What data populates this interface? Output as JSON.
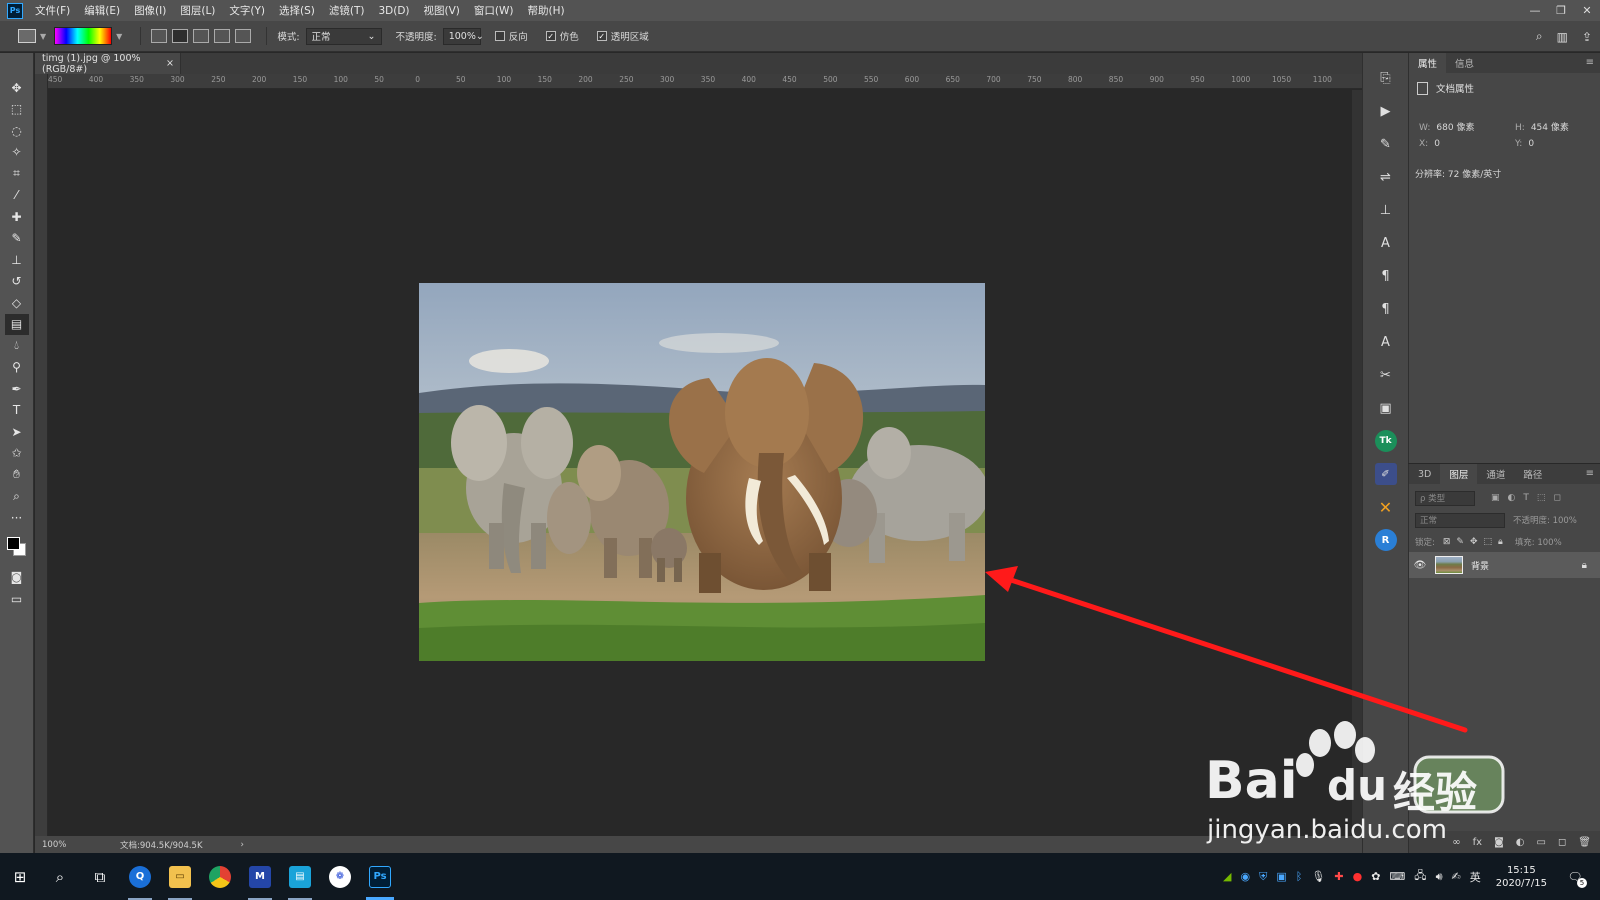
{
  "app": {
    "logo": "Ps"
  },
  "menu": [
    "文件(F)",
    "编辑(E)",
    "图像(I)",
    "图层(L)",
    "文字(Y)",
    "选择(S)",
    "滤镜(T)",
    "3D(D)",
    "视图(V)",
    "窗口(W)",
    "帮助(H)"
  ],
  "window_controls": {
    "minimize": "—",
    "restore": "❐",
    "close": "✕"
  },
  "options": {
    "mode_label": "模式:",
    "mode_value": "正常",
    "opacity_label": "不透明度:",
    "opacity_value": "100%",
    "reverse_label": "反向",
    "reverse_checked": false,
    "dither_label": "仿色",
    "dither_checked": true,
    "transparency_label": "透明区域",
    "transparency_checked": true
  },
  "document": {
    "tab_title": "timg (1).jpg @ 100%(RGB/8#)",
    "tab_close": "×",
    "zoom": "100%",
    "doc_size": "文档:904.5K/904.5K",
    "status_arrow": "›"
  },
  "ruler": {
    "labels": [
      "450",
      "400",
      "350",
      "300",
      "250",
      "200",
      "150",
      "100",
      "50",
      "0",
      "50",
      "100",
      "150",
      "200",
      "250",
      "300",
      "350",
      "400",
      "450",
      "500",
      "550",
      "600",
      "650",
      "700",
      "750",
      "800",
      "850",
      "900",
      "950",
      "1000",
      "1050",
      "1100"
    ]
  },
  "tools": [
    "move-icon",
    "marquee-icon",
    "lasso-icon",
    "magic-wand-icon",
    "crop-icon",
    "eyedropper-icon",
    "healing-icon",
    "brush-icon",
    "stamp-icon",
    "history-brush-icon",
    "eraser-icon",
    "gradient-icon",
    "blur-icon",
    "dodge-icon",
    "pen-icon",
    "type-icon",
    "path-select-icon",
    "shape-icon",
    "hand-icon",
    "zoom-icon",
    "more-icon"
  ],
  "colors": {
    "foreground": "#000000",
    "background": "#ffffff",
    "arrow": "#ff1a1a"
  },
  "properties": {
    "tabs": [
      "属性",
      "信息"
    ],
    "section": "文档属性",
    "w_label": "W:",
    "w_value": "680 像素",
    "h_label": "H:",
    "h_value": "454 像素",
    "x_label": "X:",
    "x_value": "0",
    "y_label": "Y:",
    "y_value": "0",
    "resolution": "分辨率: 72 像素/英寸"
  },
  "layers": {
    "tabs": [
      "3D",
      "图层",
      "通道",
      "路径"
    ],
    "filter_placeholder": "ρ 类型",
    "blend_mode": "正常",
    "opacity_label": "不透明度: 100%",
    "lock_label": "锁定:",
    "fill_label": "填充: 100%",
    "layer_name": "背景"
  },
  "watermark": {
    "brand": "Bai",
    "du": "du",
    "cn": "经验",
    "url": "jingyan.baidu.com"
  },
  "taskbar": {
    "time": "15:15",
    "date": "2020/7/15",
    "ime": "英",
    "notifications": "5"
  }
}
